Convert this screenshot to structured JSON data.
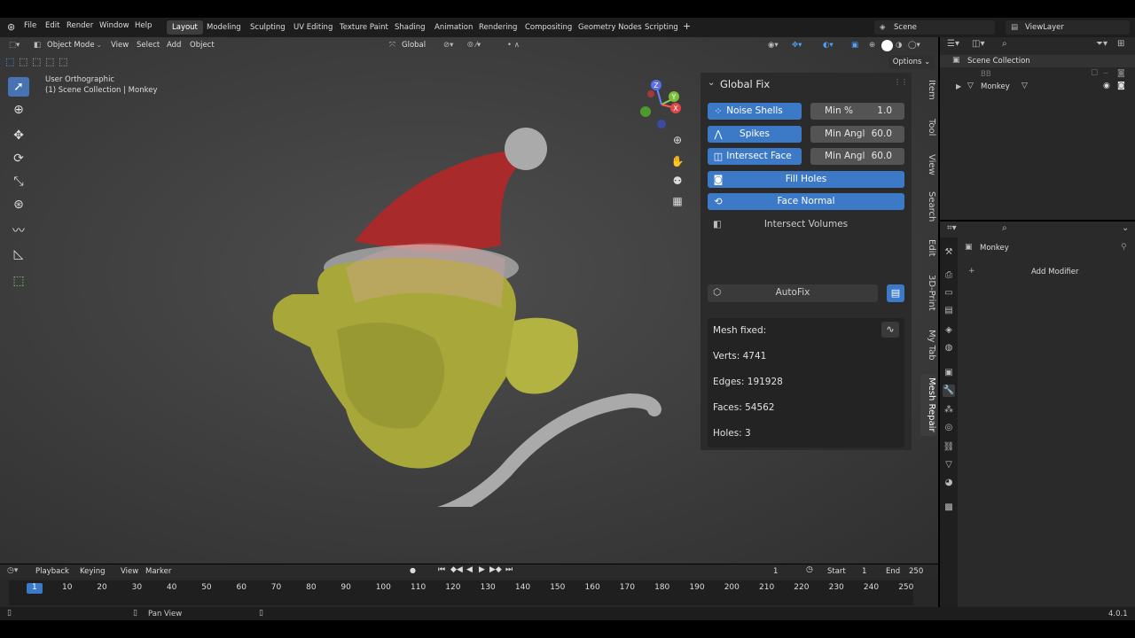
{
  "topbar": {
    "menus": [
      "File",
      "Edit",
      "Render",
      "Window",
      "Help"
    ],
    "workspaces": [
      "Layout",
      "Modeling",
      "Sculpting",
      "UV Editing",
      "Texture Paint",
      "Shading",
      "Animation",
      "Rendering",
      "Compositing",
      "Geometry Nodes",
      "Scripting"
    ],
    "scene": "Scene",
    "view_layer": "ViewLayer"
  },
  "viewport_header": {
    "mode": "Object Mode",
    "view": "View",
    "select": "Select",
    "add": "Add",
    "object": "Object",
    "orientation": "Global",
    "options": "Options"
  },
  "viewport": {
    "view_name": "User Orthographic",
    "collection_info": "(1) Scene Collection | Monkey"
  },
  "gizmo": {
    "x": "X",
    "y": "Y",
    "z": "Z"
  },
  "npanel": {
    "title": "Global Fix",
    "noise_shells": "Noise Shells",
    "noise_min_label": "Min %",
    "noise_min_value": "1.0",
    "spikes": "Spikes",
    "spikes_label": "Min Angl",
    "spikes_value": "60.0",
    "intersect_face": "Intersect Face",
    "intersect_label": "Min Angl",
    "intersect_value": "60.0",
    "fill_holes": "Fill Holes",
    "face_normal": "Face Normal",
    "intersect_volumes": "Intersect Volumes",
    "autofix": "AutoFix",
    "mesh_fixed": "Mesh fixed:",
    "verts": "Verts: 4741",
    "edges": "Edges: 191928",
    "faces": "Faces: 54562",
    "holes": "Holes: 3"
  },
  "vtabs": [
    "Item",
    "Tool",
    "View",
    "Search",
    "Edit",
    "3D-Print",
    "My Tab",
    "Mesh Repair"
  ],
  "outliner": {
    "scene_collection": "Scene Collection",
    "bb": "BB",
    "monkey": "Monkey"
  },
  "properties": {
    "object_name": "Monkey",
    "add_modifier": "Add Modifier"
  },
  "timeline": {
    "playback": "Playback",
    "keying": "Keying",
    "view": "View",
    "marker": "Marker",
    "current_frame": "1",
    "start_label": "Start",
    "start_value": "1",
    "end_label": "End",
    "end_value": "250",
    "ticks": [
      "1",
      "10",
      "20",
      "30",
      "40",
      "50",
      "60",
      "70",
      "80",
      "90",
      "100",
      "110",
      "120",
      "130",
      "140",
      "150",
      "160",
      "170",
      "180",
      "190",
      "200",
      "210",
      "220",
      "230",
      "240",
      "250"
    ]
  },
  "statusbar": {
    "pan_view": "Pan View",
    "version": "4.0.1"
  },
  "colors": {
    "accent_blue": "#3c7ac8",
    "active_tool": "#4772b3",
    "monkey_yellow": "#a8a83a",
    "hat_red": "#a82a2a"
  }
}
